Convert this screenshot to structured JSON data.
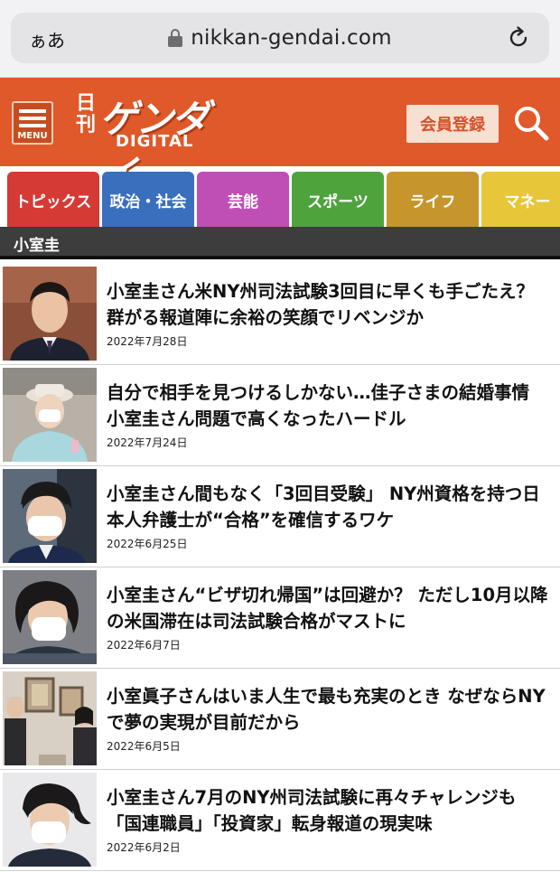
{
  "browser": {
    "aa_label": "ぁあ",
    "url": "nikkan-gendai.com",
    "lock_icon": "lock-icon",
    "reload_icon": "reload-icon"
  },
  "header": {
    "menu_label": "MENU",
    "logo_nikkan": "日刊",
    "logo_gendai": "ゲンダイ",
    "logo_digital": "DIGITAL",
    "register_label": "会員登録",
    "search_icon": "search-icon",
    "header_color": "#e0592a"
  },
  "tabs": [
    {
      "label": "トピックス",
      "color": "#d63a35"
    },
    {
      "label": "政治・社会",
      "color": "#3a6fbd"
    },
    {
      "label": "芸能",
      "color": "#c04fb5"
    },
    {
      "label": "スポーツ",
      "color": "#4ea33d"
    },
    {
      "label": "ライフ",
      "color": "#c6962d"
    },
    {
      "label": "マネー",
      "color": "#e7c63a"
    }
  ],
  "section": {
    "label": "小室圭"
  },
  "articles": [
    {
      "title": "小室圭さん米NY州司法試験3回目に早くも手ごたえ？ 群がる報道陣に余裕の笑顔でリベンジか",
      "date": "2022年7月28日"
    },
    {
      "title": "自分で相手を見つけるしかない…佳子さまの結婚事情 小室圭さん問題で高くなったハードル",
      "date": "2022年7月24日"
    },
    {
      "title": "小室圭さん間もなく「3回目受験」 NY州資格を持つ日本人弁護士が“合格”を確信するワケ",
      "date": "2022年6月25日"
    },
    {
      "title": "小室圭さん“ビザ切れ帰国”は回避か？ ただし10月以降の米国滞在は司法試験合格がマストに",
      "date": "2022年6月7日"
    },
    {
      "title": "小室眞子さんはいま人生で最も充実のとき なぜならNYで夢の実現が目前だから",
      "date": "2022年6月5日"
    },
    {
      "title": "小室圭さん7月のNY州司法試験に再々チャレンジも「国連職員」「投資家」転身報道の現実味",
      "date": "2022年6月2日"
    }
  ]
}
